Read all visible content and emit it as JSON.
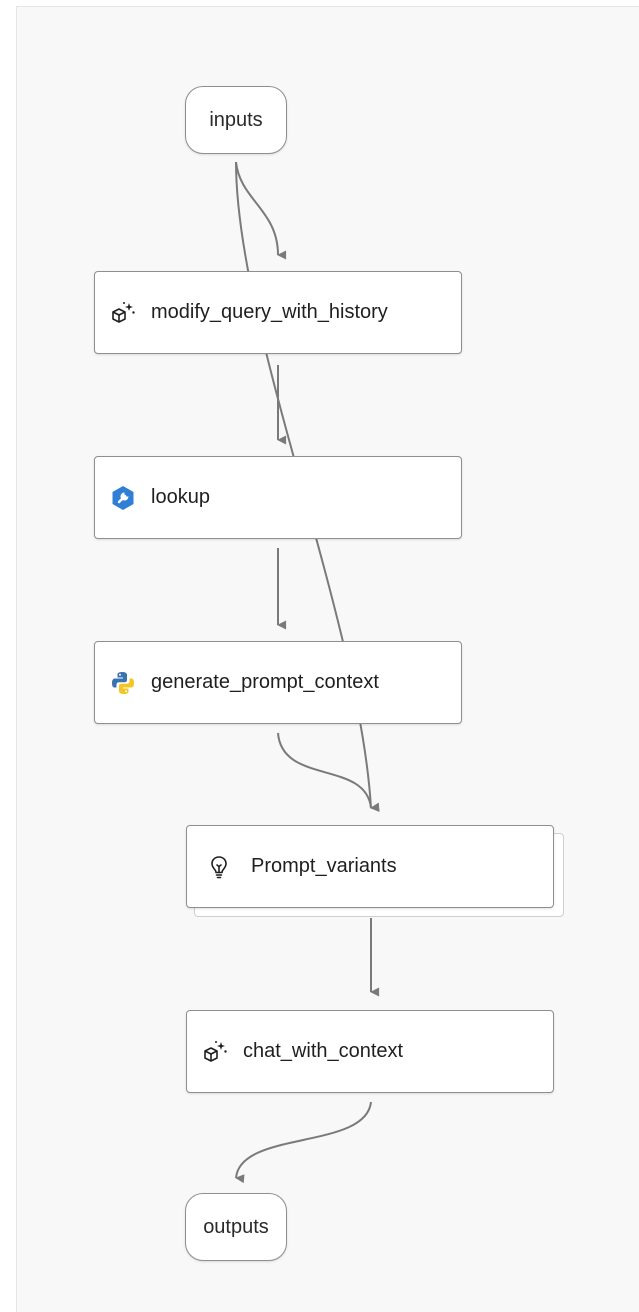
{
  "flow": {
    "nodes": {
      "inputs": {
        "label": "inputs"
      },
      "modify_query_with_history": {
        "label": "modify_query_with_history",
        "icon": "llm-sparkle-cube-icon"
      },
      "lookup": {
        "label": "lookup",
        "icon": "tool-wrench-hexagon-icon"
      },
      "generate_prompt_context": {
        "label": "generate_prompt_context",
        "icon": "python-icon"
      },
      "prompt_variants": {
        "label": "Prompt_variants",
        "icon": "lightbulb-icon"
      },
      "chat_with_context": {
        "label": "chat_with_context",
        "icon": "llm-sparkle-cube-icon"
      },
      "outputs": {
        "label": "outputs"
      }
    }
  },
  "colors": {
    "edge": "#7a7a7a",
    "node_border": "#8f8f8f",
    "canvas_bg": "#f8f8f8",
    "tool_icon": "#2f7fd6",
    "python_blue": "#3a73b0",
    "python_yellow": "#f3c623"
  }
}
